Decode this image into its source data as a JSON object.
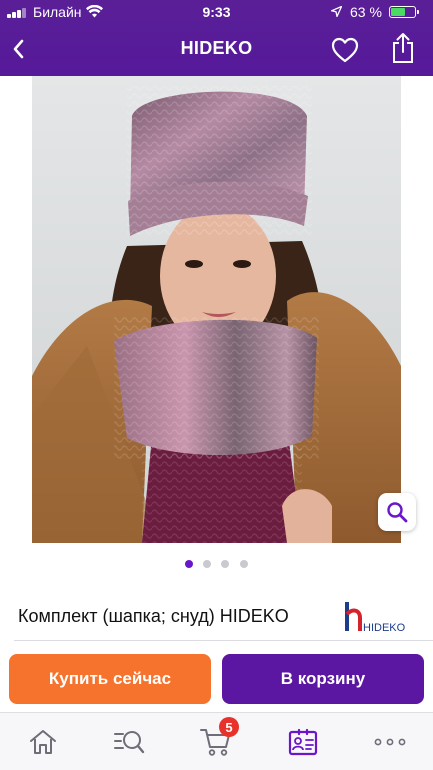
{
  "status_bar": {
    "carrier": "Билайн",
    "time": "9:33",
    "battery_percent": "63 %",
    "battery_level": 0.63
  },
  "nav": {
    "title": "HIDEKO"
  },
  "gallery": {
    "image_count": 4,
    "active_index": 0
  },
  "product": {
    "title": "Комплект (шапка; снуд) HIDEKO",
    "brand_logo_text": "HIDEKO"
  },
  "actions": {
    "buy_now_label": "Купить сейчас",
    "add_to_cart_label": "В корзину"
  },
  "tab_bar": {
    "cart_badge": "5",
    "tabs": [
      {
        "icon": "home-icon"
      },
      {
        "icon": "search-list-icon"
      },
      {
        "icon": "cart-icon"
      },
      {
        "icon": "profile-card-icon",
        "active": true
      },
      {
        "icon": "more-icon"
      }
    ]
  },
  "colors": {
    "header_purple": "#55199a",
    "buy_orange": "#f5732c",
    "cart_purple": "#5b16a2",
    "active_dot": "#6a17c9",
    "badge_red": "#e8312a",
    "battery_green": "#4cd964"
  }
}
